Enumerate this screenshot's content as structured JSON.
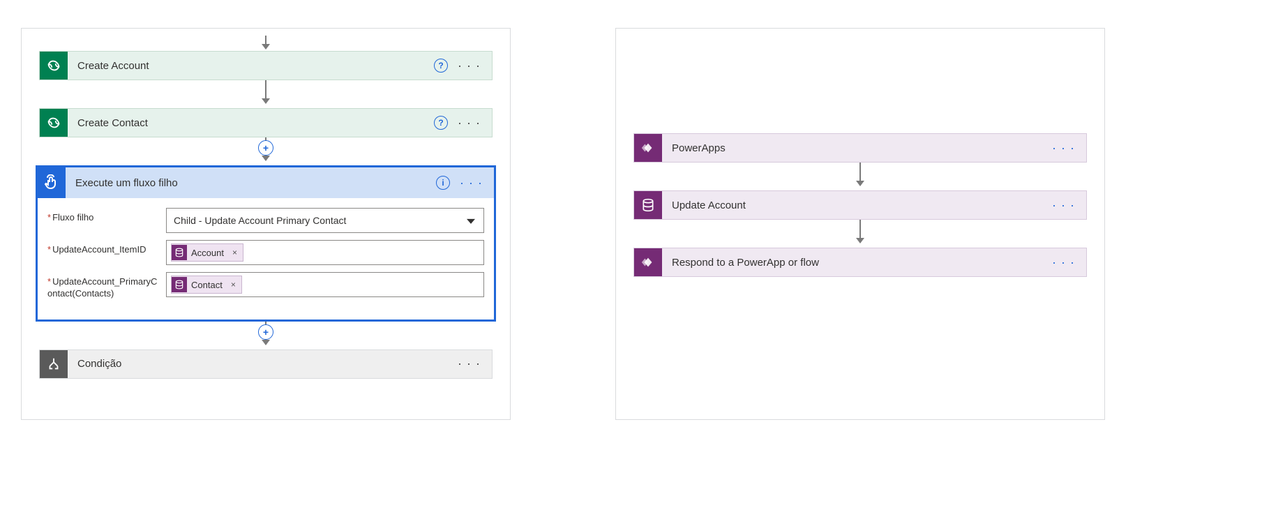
{
  "left_flow": {
    "steps": [
      {
        "title": "Create Account"
      },
      {
        "title": "Create Contact"
      }
    ],
    "child_card": {
      "title": "Execute um fluxo filho",
      "fields": [
        {
          "label": "Fluxo filho",
          "type": "select",
          "value": "Child - Update Account Primary Contact"
        },
        {
          "label": "UpdateAccount_ItemID",
          "type": "token",
          "token": "Account"
        },
        {
          "label": "UpdateAccount_PrimaryContact(Contacts)",
          "type": "token",
          "token": "Contact"
        }
      ]
    },
    "condition_title": "Condição"
  },
  "right_flow": {
    "steps": [
      {
        "title": "PowerApps",
        "icon": "powerapps"
      },
      {
        "title": "Update Account",
        "icon": "database"
      },
      {
        "title": "Respond to a PowerApp or flow",
        "icon": "powerapps"
      }
    ]
  },
  "glyphs": {
    "help": "?",
    "info": "i",
    "plus": "+",
    "x": "×",
    "ellipsis": "· · ·"
  }
}
